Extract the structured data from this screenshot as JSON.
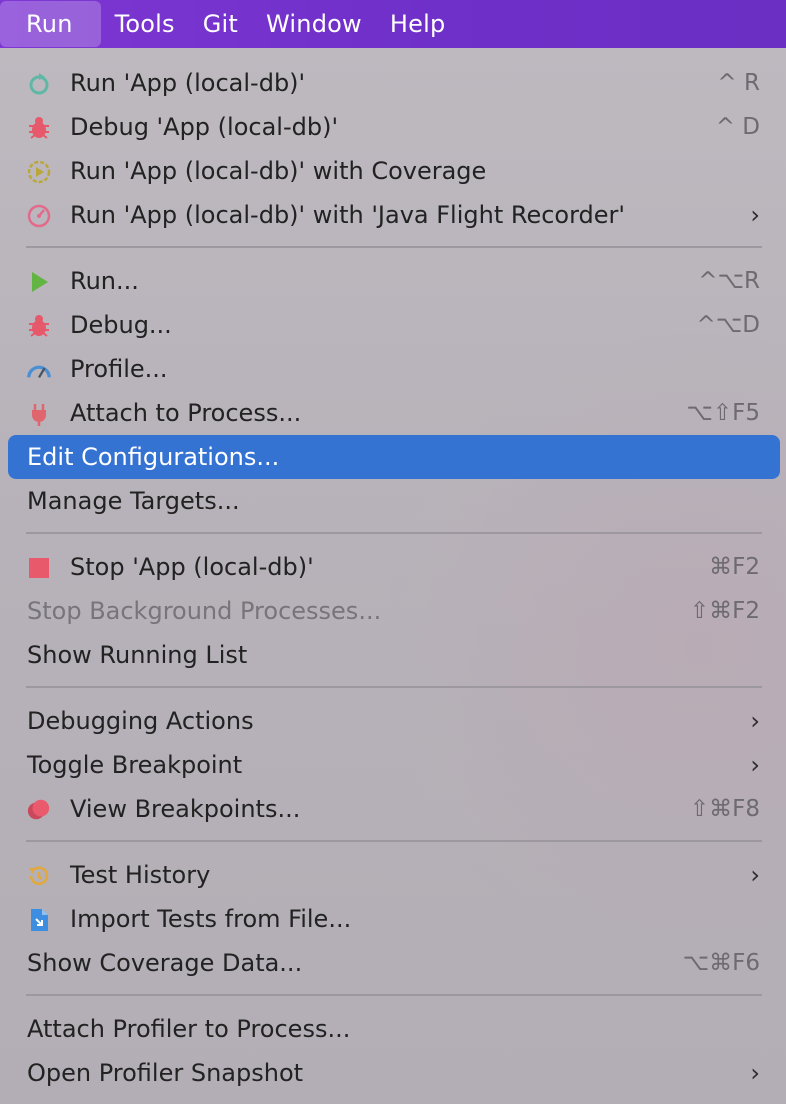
{
  "menubar": {
    "items": [
      "Run",
      "Tools",
      "Git",
      "Window",
      "Help"
    ]
  },
  "menu": {
    "items": [
      {
        "label": "Run 'App (local-db)'",
        "shortcut": "^ R",
        "icon": "run-rerun-icon"
      },
      {
        "label": "Debug 'App (local-db)'",
        "shortcut": "^ D",
        "icon": "debug-bug-icon"
      },
      {
        "label": "Run 'App (local-db)' with Coverage",
        "icon": "coverage-icon"
      },
      {
        "label": "Run 'App (local-db)' with 'Java Flight Recorder'",
        "submenu": "›",
        "icon": "flight-recorder-icon"
      },
      {
        "label": "Run...",
        "shortcut": "^⌥R",
        "icon": "run-play-icon"
      },
      {
        "label": "Debug...",
        "shortcut": "^⌥D",
        "icon": "debug-bug-icon"
      },
      {
        "label": "Profile...",
        "icon": "profiler-gauge-icon"
      },
      {
        "label": "Attach to Process...",
        "shortcut": "⌥⇧F5",
        "icon": "attach-plug-icon"
      },
      {
        "label": "Edit Configurations...",
        "selected": true
      },
      {
        "label": "Manage Targets..."
      },
      {
        "label": "Stop 'App (local-db)'",
        "shortcut": "⌘F2",
        "icon": "stop-square-icon"
      },
      {
        "label": "Stop Background Processes...",
        "shortcut": "⇧⌘F2",
        "disabled": true
      },
      {
        "label": "Show Running List"
      },
      {
        "label": "Debugging Actions",
        "submenu": "›"
      },
      {
        "label": "Toggle Breakpoint",
        "submenu": "›"
      },
      {
        "label": "View Breakpoints...",
        "shortcut": "⇧⌘F8",
        "icon": "breakpoints-icon"
      },
      {
        "label": "Test History",
        "submenu": "›",
        "icon": "history-clock-icon"
      },
      {
        "label": "Import Tests from File...",
        "icon": "import-file-icon"
      },
      {
        "label": "Show Coverage Data...",
        "shortcut": "⌥⌘F6"
      },
      {
        "label": "Attach Profiler to Process..."
      },
      {
        "label": "Open Profiler Snapshot",
        "submenu": "›"
      }
    ]
  },
  "colors": {
    "menubar": "#7435cd",
    "selection": "#3573d3",
    "menu_bg": "#b8b3ba"
  }
}
